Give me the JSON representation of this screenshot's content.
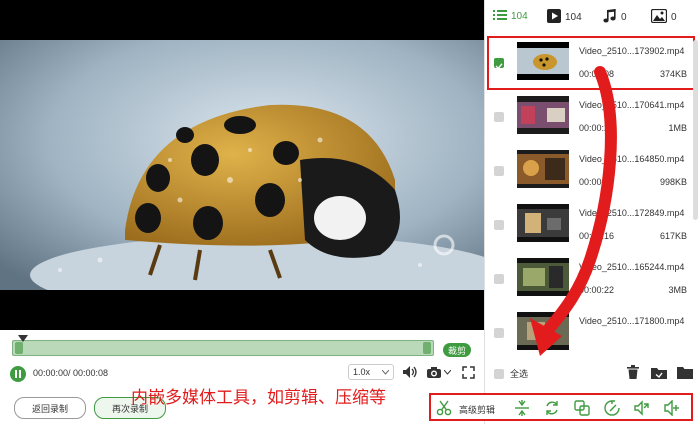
{
  "player": {
    "time_display": "00:00:00/ 00:00:08",
    "trim_label": "裁剪",
    "speed": "1.0x",
    "back_label": "返回录制",
    "rerecord_label": "再次录制",
    "icons": [
      "pause-icon",
      "volume-icon",
      "camera-icon",
      "fullscreen-icon"
    ]
  },
  "tabs": [
    {
      "label": "104",
      "icon": "list-icon",
      "active": true
    },
    {
      "label": "104",
      "icon": "video-icon",
      "active": false
    },
    {
      "label": "0",
      "icon": "music-icon",
      "active": false
    },
    {
      "label": "0",
      "icon": "image-icon",
      "active": false
    }
  ],
  "files": [
    {
      "name": "Video_2510...173902.mp4",
      "duration": "00:00:08",
      "size": "374KB",
      "checked": true
    },
    {
      "name": "Video_2510...170641.mp4",
      "duration": "00:00:23",
      "size": "1MB",
      "checked": false
    },
    {
      "name": "Video_2510...164850.mp4",
      "duration": "00:00:20",
      "size": "998KB",
      "checked": false
    },
    {
      "name": "Video_2510...172849.mp4",
      "duration": "00:00:16",
      "size": "617KB",
      "checked": false
    },
    {
      "name": "Video_2510...165244.mp4",
      "duration": "00:00:22",
      "size": "3MB",
      "checked": false
    },
    {
      "name": "Video_2510...171800.mp4",
      "duration": "",
      "size": "",
      "checked": false
    }
  ],
  "select_all_label": "全选",
  "toolbar": {
    "advanced_edit_label": "高级剪辑",
    "icons": [
      "scissors-icon",
      "compress-icon",
      "convert-icon",
      "merge-icon",
      "rotate-icon",
      "export-audio-icon",
      "add-audio-icon"
    ]
  },
  "annotation": "内嵌多媒体工具，如剪辑、压缩等",
  "colors": {
    "accent": "#3f9b3f",
    "highlight": "#e21c1c"
  }
}
